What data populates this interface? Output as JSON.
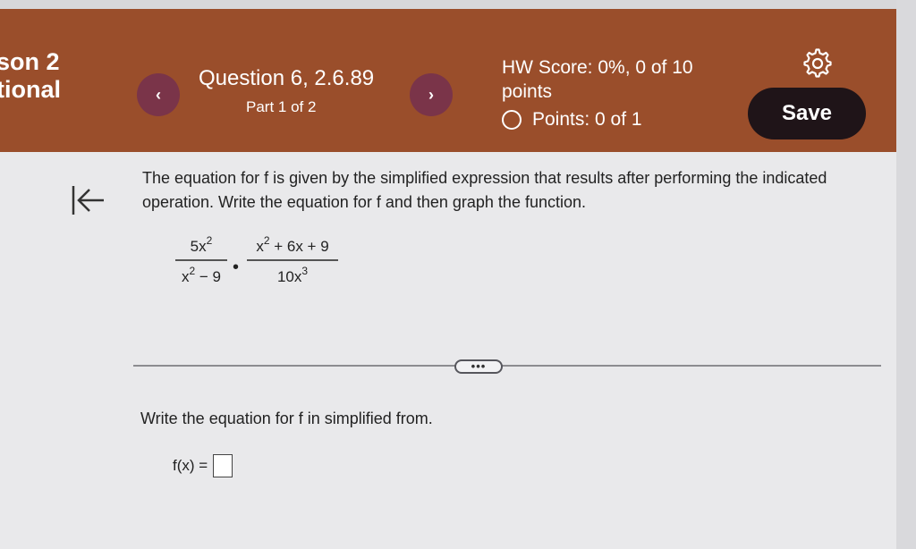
{
  "header": {
    "lesson_line1": "son 2",
    "lesson_line2": "tional",
    "prev_label": "‹",
    "next_label": "›",
    "question_title": "Question 6, 2.6.89",
    "question_part": "Part 1 of 2",
    "hw_score": "HW Score: 0%, 0 of 10 points",
    "points": "Points: 0 of 1",
    "save_label": "Save",
    "colors": {
      "bar": "#9a4e2b",
      "nav_button": "#7a3449",
      "save_button": "#1f1418"
    }
  },
  "problem": {
    "instructions": "The equation for f is given by the simplified expression that results after performing the indicated operation. Write the equation for f and then graph the function.",
    "fraction1": {
      "num_base": "5x",
      "num_exp": "2",
      "den_base": "x",
      "den_exp": "2",
      "den_rest": " − 9"
    },
    "fraction2": {
      "num_base": "x",
      "num_exp": "2",
      "num_rest": " + 6x + 9",
      "den_base": "10x",
      "den_exp": "3"
    },
    "operator": "•",
    "more_label": "•••"
  },
  "answer": {
    "prompt": "Write the equation for f in simplified from.",
    "label": "f(x) ="
  }
}
